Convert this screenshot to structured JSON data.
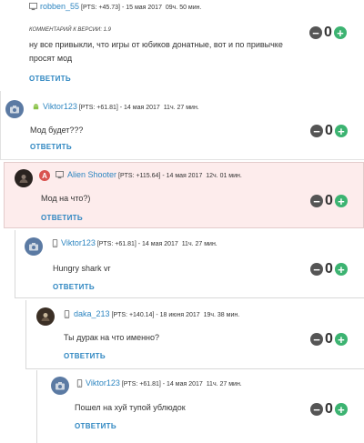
{
  "reply_label": "ОТВЕТИТЬ",
  "comments": [
    {
      "user": "robben_55",
      "pts": "[PTS: +45.73]",
      "date": "- 15 мая 2017",
      "ago": "09ч. 50 мин.",
      "note": "КОММЕНТАРИЙ К ВЕРСИИ: 1.9",
      "text": "ну все привыкли, что игры от юбиков донатные, вот и по привычке просят мод",
      "score": "0"
    },
    {
      "user": "Viktor123",
      "pts": "[PTS: +61.81]",
      "date": "- 14 мая 2017",
      "ago": "11ч. 27 мин.",
      "text": "Мод будет???",
      "score": "0"
    },
    {
      "user": "Alien Shooter",
      "badge": "A",
      "pts": "[PTS: +115.64]",
      "date": "- 14 мая 2017",
      "ago": "12ч. 01 мин.",
      "text": "Мод на что?)",
      "score": "0"
    },
    {
      "user": "Viktor123",
      "pts": "[PTS: +61.81]",
      "date": "- 14 мая 2017",
      "ago": "11ч. 27 мин.",
      "text": "Hungry shark vr",
      "score": "0"
    },
    {
      "user": "daka_213",
      "pts": "[PTS: +140.14]",
      "date": "- 18 июня 2017",
      "ago": "19ч. 38 мин.",
      "text": "Ты дурак на что именно?",
      "score": "0"
    },
    {
      "user": "Viktor123",
      "pts": "[PTS: +61.81]",
      "date": "- 14 мая 2017",
      "ago": "11ч. 27 мин.",
      "text": "Пошел на хуй тупой ублюдок",
      "score": "0"
    }
  ],
  "colors": {
    "link": "#2e86c1",
    "minus": "#555555",
    "plus": "#3cb371",
    "highlight_bg": "#fdecec"
  }
}
